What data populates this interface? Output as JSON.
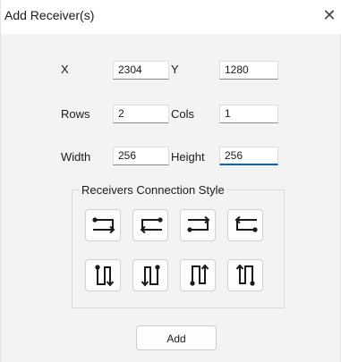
{
  "window": {
    "title": "Add Receiver(s)",
    "close_glyph": "✕"
  },
  "fields": {
    "x": {
      "label": "X",
      "value": "2304"
    },
    "y": {
      "label": "Y",
      "value": "1280"
    },
    "rows": {
      "label": "Rows",
      "value": "2"
    },
    "cols": {
      "label": "Cols",
      "value": "1"
    },
    "width": {
      "label": "Width",
      "value": "256"
    },
    "height": {
      "label": "Height",
      "value": "256"
    }
  },
  "connection_style": {
    "title": "Receivers Connection Style",
    "options": [
      {
        "icon": "horizontal-snake-top-left-start-icon"
      },
      {
        "icon": "horizontal-snake-top-right-start-icon"
      },
      {
        "icon": "horizontal-snake-bottom-left-start-icon"
      },
      {
        "icon": "horizontal-snake-bottom-right-start-icon"
      },
      {
        "icon": "vertical-snake-top-left-start-icon"
      },
      {
        "icon": "vertical-snake-top-right-start-icon"
      },
      {
        "icon": "vertical-snake-bottom-left-start-icon"
      },
      {
        "icon": "vertical-snake-bottom-right-start-icon"
      }
    ]
  },
  "buttons": {
    "add": "Add"
  }
}
